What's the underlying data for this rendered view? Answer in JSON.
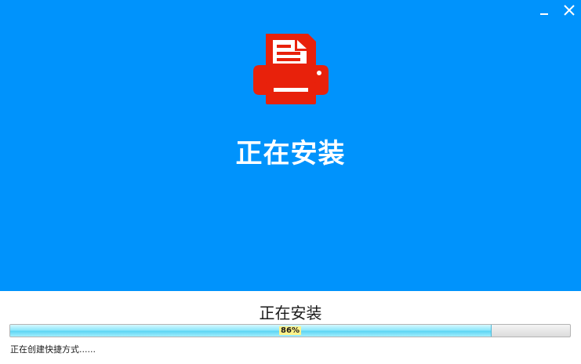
{
  "window": {
    "minimize_icon": "minimize-icon",
    "close_icon": "close-icon"
  },
  "hero": {
    "icon": "printer-icon",
    "title": "正在安装",
    "background_color": "#0093fc",
    "icon_color": "#e8210b"
  },
  "status": {
    "title": "正在安装",
    "progress_label": "86%",
    "progress_fraction": 0.86,
    "detail": "正在创建快捷方式......"
  }
}
